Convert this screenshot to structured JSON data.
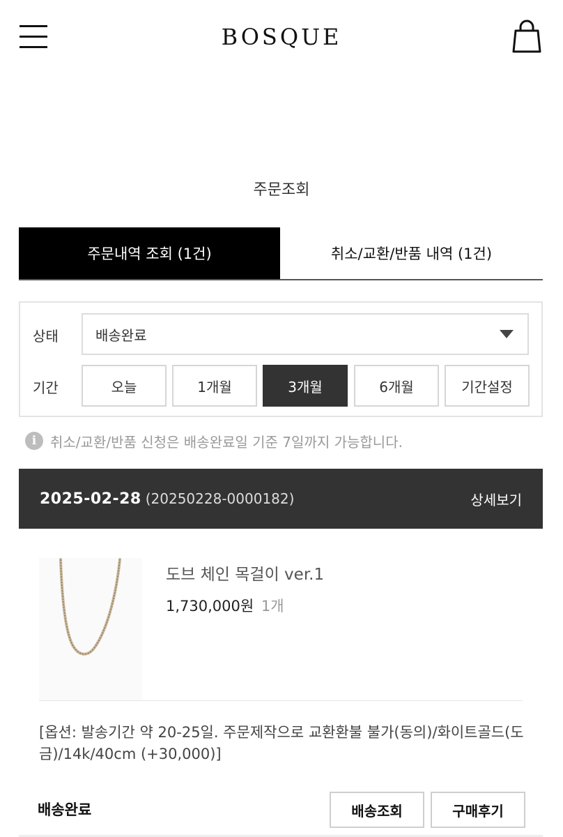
{
  "header": {
    "brand": "BOSQUE",
    "menu_icon": "hamburger-menu-icon",
    "cart_icon": "shopping-bag-icon"
  },
  "page_title": "주문조회",
  "tabs": [
    {
      "label": "주문내역 조회 (1건)",
      "active": true
    },
    {
      "label": "취소/교환/반품 내역 (1건)",
      "active": false
    }
  ],
  "filter": {
    "status_label": "상태",
    "status_value": "배송완료",
    "period_label": "기간",
    "periods": [
      {
        "label": "오늘",
        "selected": false
      },
      {
        "label": "1개월",
        "selected": false
      },
      {
        "label": "3개월",
        "selected": true
      },
      {
        "label": "6개월",
        "selected": false
      },
      {
        "label": "기간설정",
        "selected": false
      }
    ]
  },
  "notice": {
    "icon": "info-icon",
    "icon_glyph": "i",
    "text": "취소/교환/반품 신청은 배송완료일 기준 7일까지 가능합니다."
  },
  "order": {
    "date": "2025-02-28",
    "number": "(20250228-0000182)",
    "detail_label": "상세보기",
    "item": {
      "name": "도브 체인 목걸이 ver.1",
      "price": "1,730,000원",
      "qty": "1개",
      "option": "[옵션: 발송기간 약 20-25일. 주문제작으로 교환환불 불가(동의)/화이트골드(도금)/14k/40cm (+30,000)]"
    },
    "status": "배송완료",
    "buttons": {
      "track": "배송조회",
      "review": "구매후기"
    }
  },
  "colors": {
    "accent_dark": "#333333",
    "tab_active": "#000000",
    "muted_text": "#999999"
  }
}
